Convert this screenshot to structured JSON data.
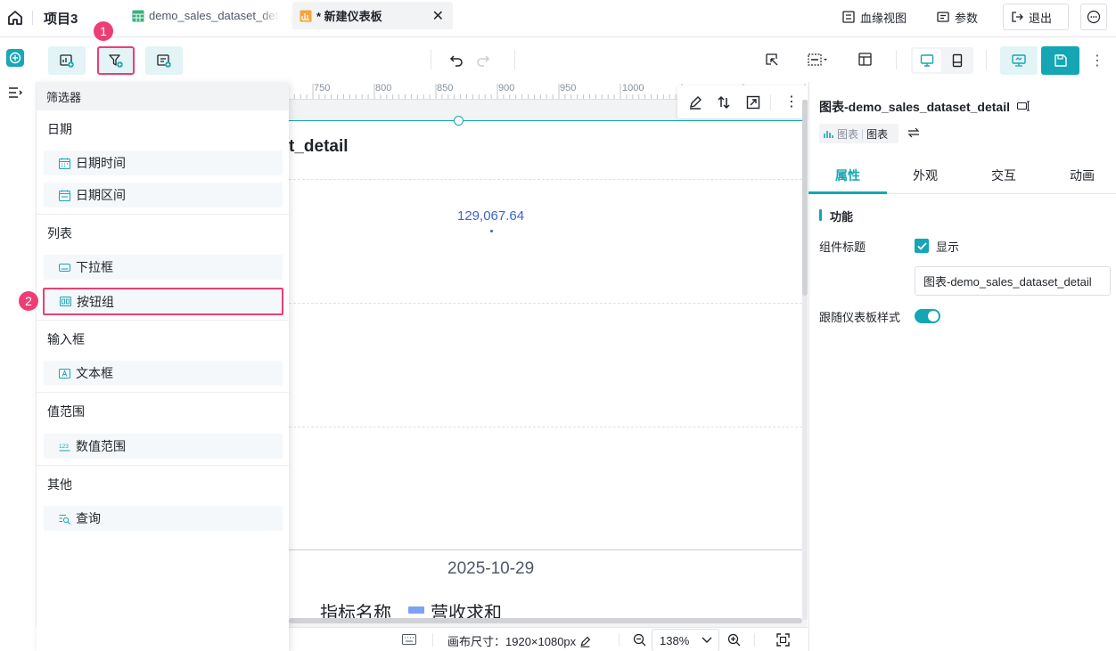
{
  "topbar": {
    "project": "项目3",
    "tabs": [
      {
        "label": "demo_sales_dataset_detail"
      },
      {
        "label": "* 新建仪表板"
      }
    ],
    "lineage_label": "血缘视图",
    "params_label": "参数",
    "exit_label": "退出"
  },
  "annotations": {
    "step1": "1",
    "step2": "2"
  },
  "filter_panel": {
    "header": "筛选器",
    "groups": [
      {
        "title": "日期",
        "items": [
          "日期时间",
          "日期区间"
        ]
      },
      {
        "title": "列表",
        "items": [
          "下拉框",
          "按钮组"
        ]
      },
      {
        "title": "输入框",
        "items": [
          "文本框"
        ]
      },
      {
        "title": "值范围",
        "items": [
          "数值范围"
        ]
      },
      {
        "title": "其他",
        "items": [
          "查询"
        ]
      }
    ]
  },
  "ruler": {
    "labels": [
      "750",
      "800",
      "850",
      "900",
      "950",
      "1000"
    ]
  },
  "chart": {
    "title_visible": "t_detail",
    "value_label": "129,067.64",
    "date_label": "2025-10-29",
    "legend_title": "指标名称",
    "legend_series": "营收求和",
    "series_color": "#7ea2f1"
  },
  "statusbar": {
    "canvas_size": "画布尺寸：1920×1080px",
    "zoom": "138%"
  },
  "props": {
    "title": "图表-demo_sales_dataset_detail",
    "type_chip_category": "图表",
    "type_chip_value": "图表",
    "tabs": [
      "属性",
      "外观",
      "交互",
      "动画"
    ],
    "section": "功能",
    "component_title_label": "组件标题",
    "show_label": "显示",
    "title_input_value": "图表-demo_sales_dataset_detail",
    "follow_style_label": "跟随仪表板样式"
  },
  "colors": {
    "accent": "#14a6b5",
    "highlight": "#ec3e74"
  }
}
